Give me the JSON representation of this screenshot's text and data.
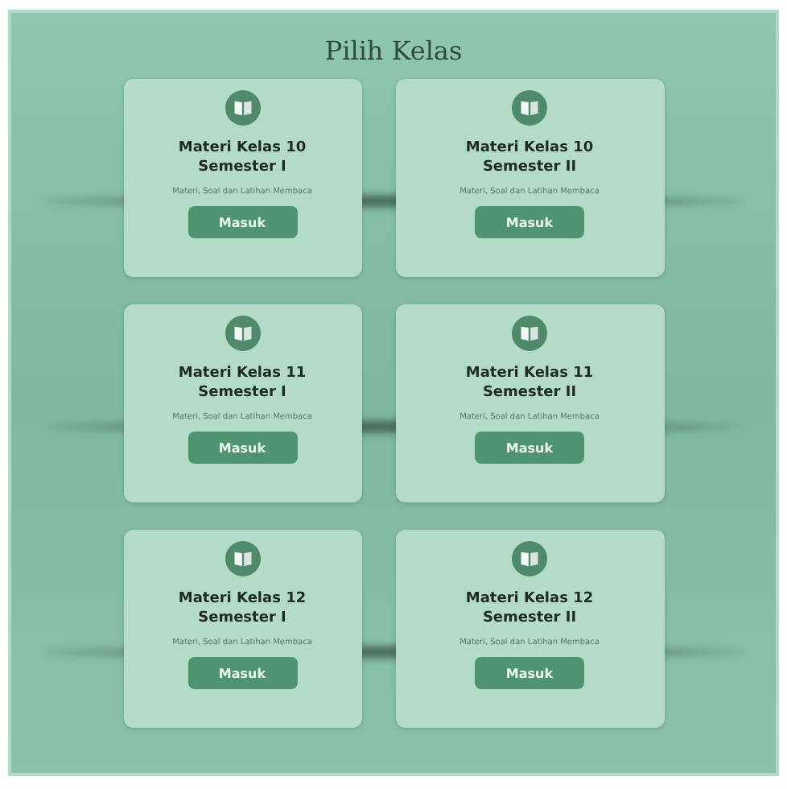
{
  "title": "Pilih Kelas",
  "cards": [
    {
      "title": "Materi Kelas 10",
      "semester": "Semester I",
      "description": "Materi, Soal dan Latihan Membaca",
      "button": "Masuk"
    },
    {
      "title": "Materi Kelas 10",
      "semester": "Semester II",
      "description": "Materi, Soal dan Latihan Membaca",
      "button": "Masuk"
    },
    {
      "title": "Materi Kelas 11",
      "semester": "Semester I",
      "description": "Materi, Soal dan Latihan Membaca",
      "button": "Masuk"
    },
    {
      "title": "Materi Kelas 11",
      "semester": "Semester II",
      "description": "Materi, Soal dan Latihan Membaca",
      "button": "Masuk"
    },
    {
      "title": "Materi Kelas 12",
      "semester": "Semester I",
      "description": "Materi, Soal dan Latihan Membaca",
      "button": "Masuk"
    },
    {
      "title": "Materi Kelas 12",
      "semester": "Semester II",
      "description": "Materi, Soal dan Latihan Membaca",
      "button": "Masuk"
    }
  ]
}
